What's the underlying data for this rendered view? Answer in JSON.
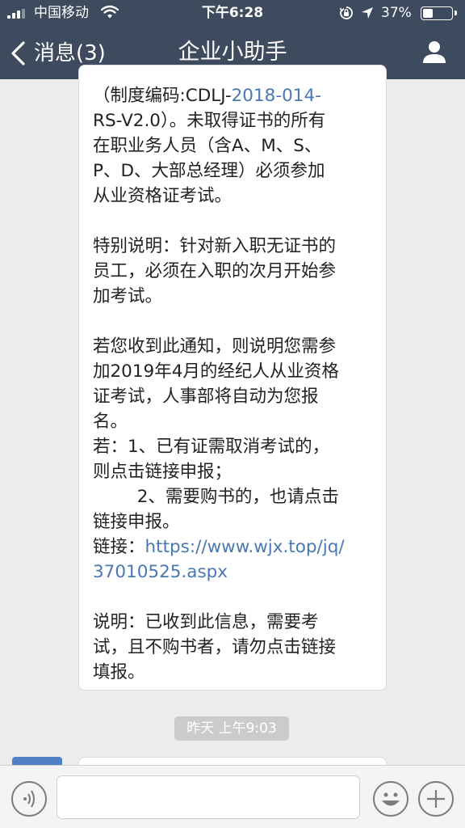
{
  "status_bar": {
    "carrier": "中国移动",
    "time": "下午6:28",
    "battery_percent": "37%",
    "battery_level": 0.37,
    "icons": [
      "signal-icon",
      "wifi-icon",
      "orientation-lock-icon",
      "location-icon",
      "battery-icon"
    ]
  },
  "nav": {
    "back_label": "消息(3)",
    "title": "企业小助手",
    "icons": [
      "chevron-left-icon",
      "profile-icon"
    ]
  },
  "message": {
    "lines": [
      {
        "text": "（制度编码:CDLJ-"
      },
      {
        "text": "2018-014-",
        "style": "link"
      },
      {
        "text": "\nRS-V2.0）。未取得证书的所有\n在职业务人员（含A、M、S、\nP、D、大部总经理）必须参加\n从业资格证考试。\n\n特别说明：针对新入职无证书的\n员工，必须在入职的次月开始参\n加考试。\n\n若您收到此通知，则说明您需参\n加2019年4月的经纪人从业资格\n证考试，人事部将自动为您报\n名。\n若：1、已有证需取消考试的，\n则点击链接申报；\n        2、需要购书的，也请点击\n链接申报。\n链接："
      },
      {
        "text": "https://www.wjx.top/jq/\n37010525.aspx",
        "style": "link"
      },
      {
        "text": "\n\n说明：已收到此信息，需要考\n试，且不购书者，请勿点击链接\n填报。"
      }
    ]
  },
  "timestamp": "昨天 上午9:03",
  "input_bar": {
    "placeholder": "",
    "icons": [
      "voice-icon",
      "emoji-icon",
      "plus-icon"
    ]
  },
  "colors": {
    "nav_bg": "#3e4a5e",
    "chat_bg": "#ececec",
    "link": "#4a78b4",
    "timestamp_bg": "#cbcbcb"
  }
}
